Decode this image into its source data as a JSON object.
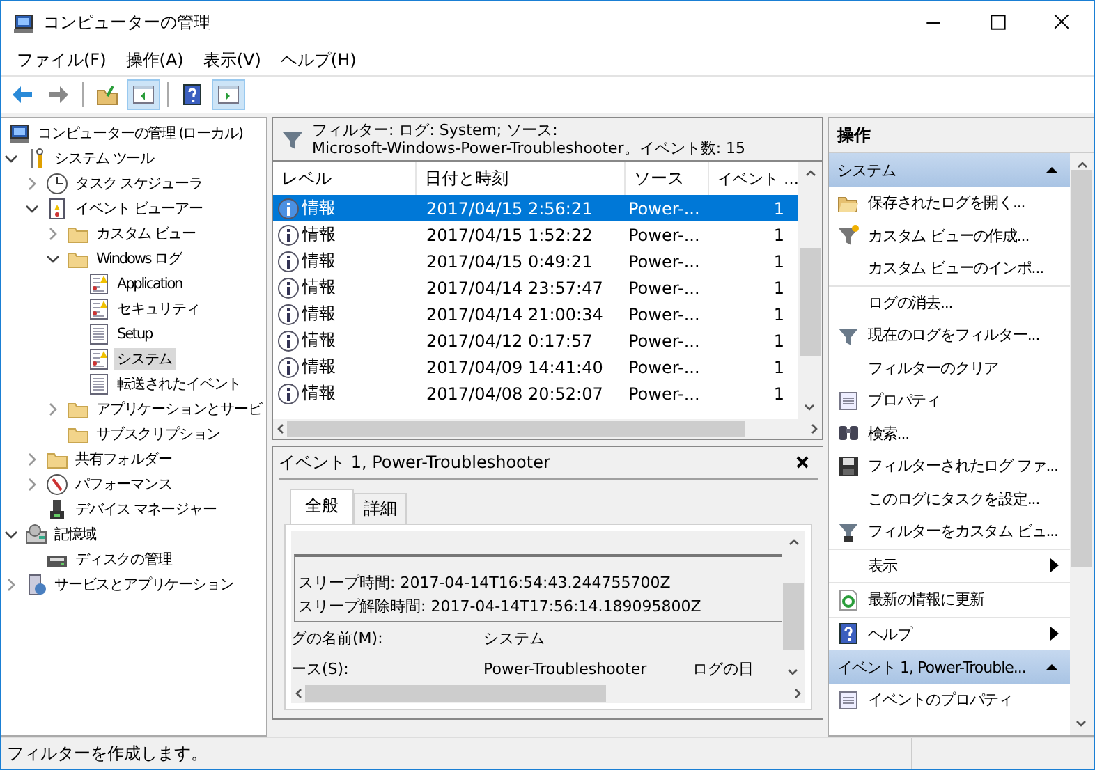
{
  "window": {
    "title": "コンピューターの管理"
  },
  "menu": [
    {
      "label": "ファイル(F)"
    },
    {
      "label": "操作(A)"
    },
    {
      "label": "表示(V)"
    },
    {
      "label": "ヘルプ(H)"
    }
  ],
  "toolbar": [
    [
      {
        "kind": "back",
        "pressed": false
      },
      {
        "kind": "forward",
        "pressed": false
      }
    ],
    [
      {
        "kind": "up",
        "pressed": false
      },
      {
        "kind": "tree-toggle",
        "pressed": true
      }
    ],
    [
      {
        "kind": "help",
        "pressed": false
      },
      {
        "kind": "action-toggle",
        "pressed": true
      }
    ]
  ],
  "tree": [
    {
      "label": "コンピューターの管理 (ローカル)",
      "kind": "computer",
      "selected": false,
      "children": [
        {
          "label": "システム ツール",
          "kind": "tools",
          "expanded": true,
          "selected": false,
          "children": [
            {
              "label": "タスク スケジューラ",
              "kind": "clock",
              "expanded": false,
              "selected": false
            },
            {
              "label": "イベント ビューアー",
              "kind": "eventlog",
              "expanded": true,
              "selected": false,
              "children": [
                {
                  "label": "カスタム ビュー",
                  "kind": "folder",
                  "expanded": false,
                  "selected": false
                },
                {
                  "label": "Windows ログ",
                  "kind": "folder",
                  "expanded": true,
                  "selected": false,
                  "children": [
                    {
                      "label": "Application",
                      "kind": "log-warn",
                      "selected": false
                    },
                    {
                      "label": "セキュリティ",
                      "kind": "log-warn",
                      "selected": false
                    },
                    {
                      "label": "Setup",
                      "kind": "log",
                      "selected": false
                    },
                    {
                      "label": "システム",
                      "kind": "log-warn",
                      "selected": true
                    },
                    {
                      "label": "転送されたイベント",
                      "kind": "log",
                      "selected": false
                    }
                  ]
                },
                {
                  "label": "アプリケーションとサービ",
                  "kind": "folder",
                  "expanded": false,
                  "selected": false
                },
                {
                  "label": "サブスクリプション",
                  "kind": "folder",
                  "selected": false
                }
              ]
            },
            {
              "label": "共有フォルダー",
              "kind": "folder",
              "expanded": false,
              "selected": false
            },
            {
              "label": "パフォーマンス",
              "kind": "perf",
              "expanded": false,
              "selected": false
            },
            {
              "label": "デバイス マネージャー",
              "kind": "device",
              "selected": false
            }
          ]
        },
        {
          "label": "記憶域",
          "kind": "storage",
          "expanded": true,
          "selected": false,
          "children": [
            {
              "label": "ディスクの管理",
              "kind": "disk",
              "selected": false
            }
          ]
        },
        {
          "label": "サービスとアプリケーション",
          "kind": "services",
          "expanded": false,
          "selected": false
        }
      ]
    }
  ],
  "filter": {
    "lines": [
      "フィルター: ログ: System; ソース:",
      "Microsoft-Windows-Power-Troubleshooter。イベント数: 15"
    ]
  },
  "events": {
    "columns": [
      "レベル",
      "日付と時刻",
      "ソース",
      "イベント …"
    ],
    "rows": [
      {
        "level": "情報",
        "datetime": "2017/04/15 2:56:21",
        "source": "Power-...",
        "event_id": "1",
        "selected": true
      },
      {
        "level": "情報",
        "datetime": "2017/04/15 1:52:22",
        "source": "Power-...",
        "event_id": "1",
        "selected": false
      },
      {
        "level": "情報",
        "datetime": "2017/04/15 0:49:21",
        "source": "Power-...",
        "event_id": "1",
        "selected": false
      },
      {
        "level": "情報",
        "datetime": "2017/04/14 23:57:47",
        "source": "Power-...",
        "event_id": "1",
        "selected": false
      },
      {
        "level": "情報",
        "datetime": "2017/04/14 21:00:34",
        "source": "Power-...",
        "event_id": "1",
        "selected": false
      },
      {
        "level": "情報",
        "datetime": "2017/04/12 0:17:57",
        "source": "Power-...",
        "event_id": "1",
        "selected": false
      },
      {
        "level": "情報",
        "datetime": "2017/04/09 14:41:40",
        "source": "Power-...",
        "event_id": "1",
        "selected": false
      },
      {
        "level": "情報",
        "datetime": "2017/04/08 20:52:07",
        "source": "Power-...",
        "event_id": "1",
        "selected": false
      }
    ]
  },
  "detail": {
    "title": "イベント 1, Power-Troubleshooter",
    "tabs": [
      {
        "label": "全般",
        "selected": true
      },
      {
        "label": "詳細",
        "selected": false
      }
    ],
    "description": [
      "スリープ時間: 2017-04-14T16:54:43.244755700Z",
      "スリープ解除時間: 2017-04-14T17:56:14.189095800Z"
    ],
    "fields": [
      {
        "label": "グの名前(M):",
        "value": "システム"
      },
      {
        "label": "ース(S):",
        "value": "Power-Troubleshooter",
        "label_2": "ログの日"
      }
    ]
  },
  "actions": {
    "title": "操作",
    "sections": [
      {
        "title": "システム",
        "expanded": true,
        "items": [
          {
            "label": "保存されたログを開く...",
            "kind": "open-folder",
            "separated": false,
            "submenu": false
          },
          {
            "label": "カスタム ビューの作成...",
            "kind": "funnel-star",
            "separated": false,
            "submenu": false
          },
          {
            "label": "カスタム ビューのインポ...",
            "kind": "none",
            "separated": false,
            "submenu": false
          },
          {
            "label": "ログの消去...",
            "kind": "none",
            "separated": true,
            "submenu": false
          },
          {
            "label": "現在のログをフィルター...",
            "kind": "funnel",
            "separated": false,
            "submenu": false
          },
          {
            "label": "フィルターのクリア",
            "kind": "none",
            "separated": false,
            "submenu": false
          },
          {
            "label": "プロパティ",
            "kind": "properties",
            "separated": false,
            "submenu": false
          },
          {
            "label": "検索...",
            "kind": "binoculars",
            "separated": false,
            "submenu": false
          },
          {
            "label": "フィルターされたログ ファ...",
            "kind": "floppy",
            "separated": false,
            "submenu": false
          },
          {
            "label": "このログにタスクを設定...",
            "kind": "none",
            "separated": false,
            "submenu": false
          },
          {
            "label": "フィルターをカスタム ビュ...",
            "kind": "funnel-save",
            "separated": false,
            "submenu": false
          },
          {
            "label": "表示",
            "kind": "none",
            "separated": true,
            "submenu": true
          },
          {
            "label": "最新の情報に更新",
            "kind": "refresh",
            "separated": true,
            "submenu": false
          },
          {
            "label": "ヘルプ",
            "kind": "help",
            "separated": true,
            "submenu": true
          }
        ]
      },
      {
        "title": "イベント 1, Power-Trouble...",
        "expanded": true,
        "items": [
          {
            "label": "イベントのプロパティ",
            "kind": "properties",
            "separated": false,
            "submenu": false
          }
        ]
      }
    ]
  },
  "status_bar": {
    "text": "フィルターを作成します。"
  }
}
